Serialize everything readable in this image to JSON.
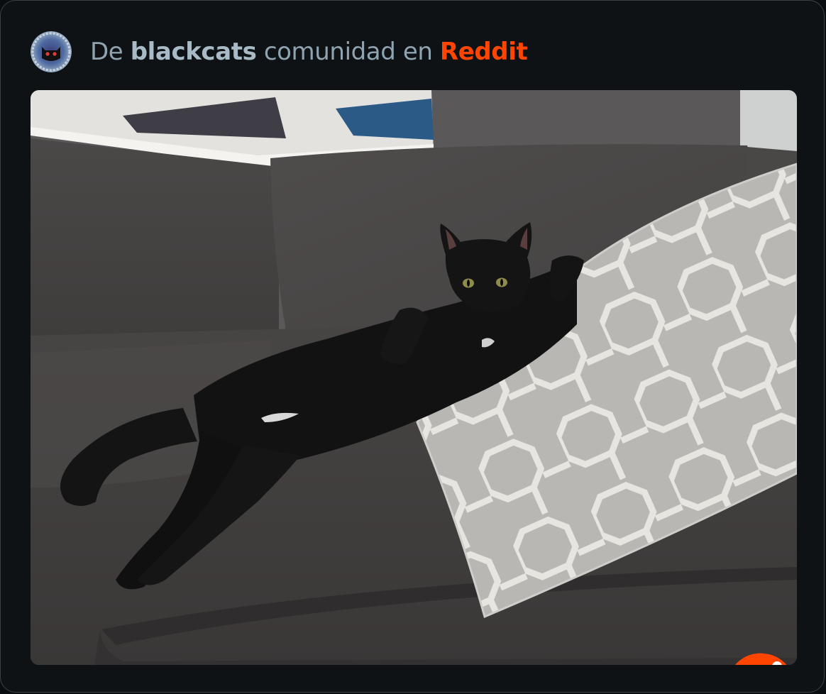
{
  "post_source": {
    "prefix": "De",
    "community": "blackcats",
    "middle": "comunidad en",
    "platform": "Reddit"
  },
  "colors": {
    "brand": "#ff4500",
    "background": "#0e1215",
    "text_muted": "#8fa3b0"
  },
  "media": {
    "kind": "photo",
    "badge_icon": "reddit-logo-icon"
  }
}
